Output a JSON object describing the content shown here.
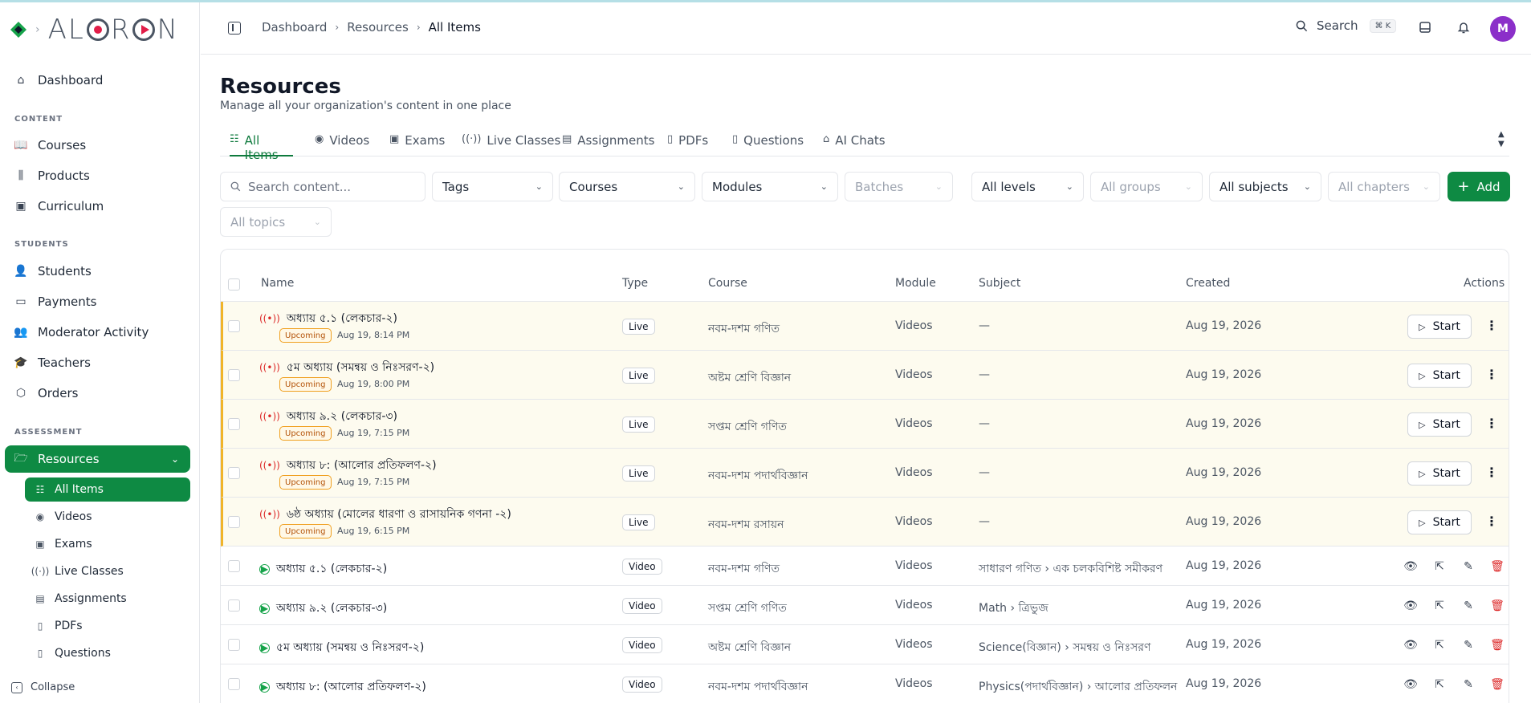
{
  "brand": {
    "name": "ALORON"
  },
  "sidebar": {
    "top": [
      {
        "label": "Dashboard",
        "icon": "home-icon"
      }
    ],
    "sections": [
      {
        "label": "CONTENT",
        "items": [
          {
            "label": "Courses",
            "icon": "book-icon"
          },
          {
            "label": "Products",
            "icon": "library-icon"
          },
          {
            "label": "Curriculum",
            "icon": "book-open-icon"
          }
        ]
      },
      {
        "label": "STUDENTS",
        "items": [
          {
            "label": "Students",
            "icon": "user-icon"
          },
          {
            "label": "Payments",
            "icon": "credit-card-icon"
          },
          {
            "label": "Moderator Activity",
            "icon": "users-icon"
          },
          {
            "label": "Teachers",
            "icon": "graduation-cap-icon"
          },
          {
            "label": "Orders",
            "icon": "package-icon"
          }
        ]
      },
      {
        "label": "ASSESSMENT",
        "items": [
          {
            "label": "Resources",
            "icon": "folder-open-icon",
            "active": true
          }
        ]
      }
    ],
    "resources_sub": [
      {
        "label": "All Items",
        "active": true
      },
      {
        "label": "Videos"
      },
      {
        "label": "Exams"
      },
      {
        "label": "Live Classes"
      },
      {
        "label": "Assignments"
      },
      {
        "label": "PDFs"
      },
      {
        "label": "Questions"
      }
    ],
    "collapse_label": "Collapse"
  },
  "header": {
    "breadcrumbs": [
      "Dashboard",
      "Resources",
      "All Items"
    ],
    "search_label": "Search",
    "search_shortcut": "⌘ K",
    "avatar_initial": "M"
  },
  "page": {
    "title": "Resources",
    "subtitle": "Manage all your organization's content in one place"
  },
  "tabs": [
    {
      "label": "All Items",
      "active": true
    },
    {
      "label": "Videos"
    },
    {
      "label": "Exams"
    },
    {
      "label": "Live Classes"
    },
    {
      "label": "Assignments"
    },
    {
      "label": "PDFs"
    },
    {
      "label": "Questions"
    },
    {
      "label": "AI Chats"
    }
  ],
  "filters": {
    "search_placeholder": "Search content...",
    "tags": "Tags",
    "courses": "Courses",
    "modules": "Modules",
    "batches": "Batches",
    "levels": "All levels",
    "groups": "All groups",
    "subjects": "All subjects",
    "chapters": "All chapters",
    "topics": "All topics",
    "add_label": "Add"
  },
  "table": {
    "columns": {
      "name": "Name",
      "type": "Type",
      "course": "Course",
      "module": "Module",
      "subject": "Subject",
      "created": "Created",
      "actions": "Actions"
    },
    "start_label": "Start",
    "rows": [
      {
        "kind": "live",
        "name": "অধ্যায় ৫.১ (লেকচার-২)",
        "status": "Upcoming",
        "when": "Aug 19, 8:14 PM",
        "type": "Live",
        "course": "নবম-দশম গণিত",
        "module": "Videos",
        "subject": "—",
        "created": "Aug 19, 2026"
      },
      {
        "kind": "live",
        "name": "৫ম অধ্যায় (সমন্বয় ও নিঃসরণ-২)",
        "status": "Upcoming",
        "when": "Aug 19, 8:00 PM",
        "type": "Live",
        "course": "অষ্টম শ্রেণি বিজ্ঞান",
        "module": "Videos",
        "subject": "—",
        "created": "Aug 19, 2026"
      },
      {
        "kind": "live",
        "name": "অধ্যায় ৯.২ (লেকচার-৩)",
        "status": "Upcoming",
        "when": "Aug 19, 7:15 PM",
        "type": "Live",
        "course": "সপ্তম শ্রেণি গণিত",
        "module": "Videos",
        "subject": "—",
        "created": "Aug 19, 2026"
      },
      {
        "kind": "live",
        "name": "অধ্যায় ৮: (আলোর প্রতিফলণ-২)",
        "status": "Upcoming",
        "when": "Aug 19, 7:15 PM",
        "type": "Live",
        "course": "নবম-দশম পদার্থবিজ্ঞান",
        "module": "Videos",
        "subject": "—",
        "created": "Aug 19, 2026"
      },
      {
        "kind": "live",
        "name": "৬ষ্ঠ অধ্যায় (মোলের ধারণা ও রাসায়নিক গণনা -২)",
        "status": "Upcoming",
        "when": "Aug 19, 6:15 PM",
        "type": "Live",
        "course": "নবম-দশম রসায়ন",
        "module": "Videos",
        "subject": "—",
        "created": "Aug 19, 2026"
      },
      {
        "kind": "video",
        "name": "অধ্যায় ৫.১ (লেকচার-২)",
        "type": "Video",
        "course": "নবম-দশম গণিত",
        "module": "Videos",
        "subject": "সাধারণ গণিত › এক চলকবিশিষ্ট সমীকরণ",
        "created": "Aug 19, 2026"
      },
      {
        "kind": "video",
        "name": "অধ্যায় ৯.২ (লেকচার-৩)",
        "type": "Video",
        "course": "সপ্তম শ্রেণি গণিত",
        "module": "Videos",
        "subject": "Math › ত্রিভুজ",
        "created": "Aug 19, 2026"
      },
      {
        "kind": "video",
        "name": "৫ম অধ্যায় (সমন্বয় ও নিঃসরণ-২)",
        "type": "Video",
        "course": "অষ্টম শ্রেণি বিজ্ঞান",
        "module": "Videos",
        "subject": "Science(বিজ্ঞান) › সমন্বয় ও নিঃসরণ",
        "created": "Aug 19, 2026"
      },
      {
        "kind": "video",
        "name": "অধ্যায় ৮: (আলোর প্রতিফলণ-২)",
        "type": "Video",
        "course": "নবম-দশম পদার্থবিজ্ঞান",
        "module": "Videos",
        "subject": "Physics(পদার্থবিজ্ঞান) › আলোর প্রতিফলন",
        "created": "Aug 19, 2026"
      }
    ]
  },
  "colors": {
    "brand_green": "#0e8a43",
    "live_red": "#dc2626",
    "upcoming_amber": "#f0a020"
  }
}
